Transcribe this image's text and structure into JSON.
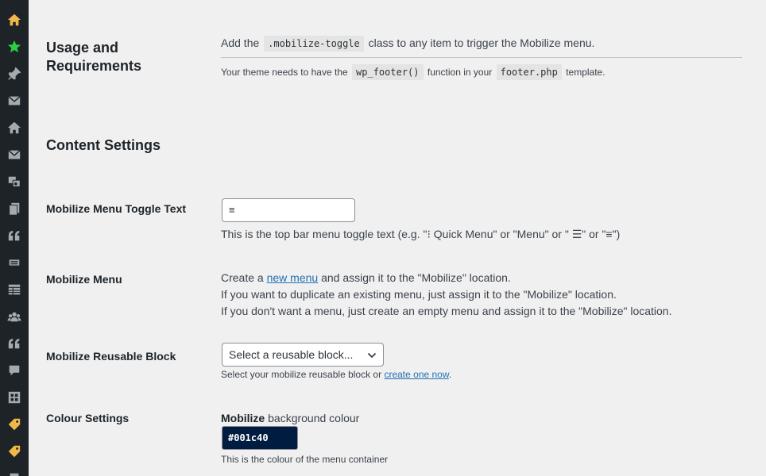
{
  "sidebar": {
    "icons": [
      {
        "name": "home-icon",
        "color": "#f0b849"
      },
      {
        "name": "star-icon",
        "color": "#2ecc40"
      },
      {
        "name": "pin-icon",
        "color": "#a7aaad"
      },
      {
        "name": "mail-icon",
        "color": "#a7aaad"
      },
      {
        "name": "house-icon",
        "color": "#a7aaad"
      },
      {
        "name": "envelope-icon",
        "color": "#a7aaad"
      },
      {
        "name": "media-icon",
        "color": "#a7aaad"
      },
      {
        "name": "pages-icon",
        "color": "#a7aaad"
      },
      {
        "name": "quote-icon",
        "color": "#a7aaad"
      },
      {
        "name": "slider-icon",
        "color": "#a7aaad"
      },
      {
        "name": "table-icon",
        "color": "#a7aaad"
      },
      {
        "name": "groups-icon",
        "color": "#a7aaad"
      },
      {
        "name": "testimonial-icon",
        "color": "#a7aaad"
      },
      {
        "name": "comment-icon",
        "color": "#a7aaad"
      },
      {
        "name": "gallery-icon",
        "color": "#a7aaad"
      },
      {
        "name": "tag-icon",
        "color": "#f0b849"
      },
      {
        "name": "tag-icon-2",
        "color": "#f0b849"
      },
      {
        "name": "tools-icon",
        "color": "#a7aaad"
      }
    ]
  },
  "usage": {
    "heading_line1": "Usage and",
    "heading_line2": "Requirements",
    "line1_before": "Add the",
    "line1_code": ".mobilize-toggle",
    "line1_after": "class to any item to trigger the Mobilize menu.",
    "line2_before": "Your theme needs to have the",
    "line2_code1": "wp_footer()",
    "line2_mid": "function in your",
    "line2_code2": "footer.php",
    "line2_after": "template."
  },
  "content_settings": {
    "heading": "Content Settings"
  },
  "toggle_text": {
    "label": "Mobilize Menu Toggle Text",
    "value": "≡",
    "description": "This is the top bar menu toggle text (e.g. \"⁝ Quick Menu\" or \"Menu\" or \" ☰\" or \"≡\")"
  },
  "menu": {
    "label": "Mobilize Menu",
    "line1_before": "Create a",
    "line1_link": "new menu",
    "line1_after": "and assign it to the \"Mobilize\" location.",
    "line2": "If you want to duplicate an existing menu, just assign it to the \"Mobilize\" location.",
    "line3": "If you don't want a menu, just create an empty menu and assign it to the \"Mobilize\" location."
  },
  "reusable_block": {
    "label": "Mobilize Reusable Block",
    "select_value": "Select a reusable block...",
    "desc_before": "Select your mobilize reusable block or",
    "desc_link": "create one now",
    "desc_after": "."
  },
  "colour": {
    "label": "Colour Settings",
    "field_bold": "Mobilize",
    "field_rest": "background colour",
    "value": "#001c40",
    "swatch_color": "#001c40",
    "description": "This is the colour of the menu container"
  }
}
